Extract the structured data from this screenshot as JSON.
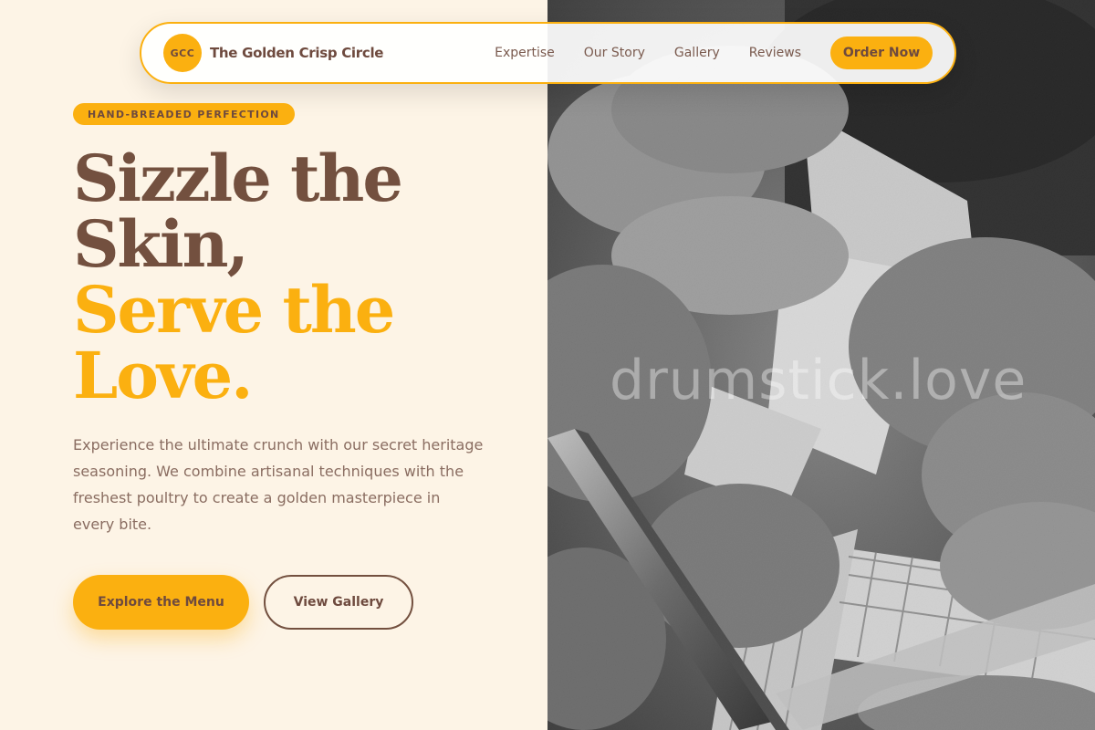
{
  "nav": {
    "logo_initials": "GCC",
    "brand_name": "The Golden Crisp Circle",
    "links": [
      "Expertise",
      "Our Story",
      "Gallery",
      "Reviews"
    ],
    "cta_label": "Order Now"
  },
  "hero": {
    "eyebrow": "HAND-BREADED PERFECTION",
    "headline_lines": [
      "Sizzle the",
      "Skin,",
      "Serve the",
      "Love."
    ],
    "description": "Experience the ultimate crunch with our secret heritage seasoning. We combine artisanal techniques with the freshest poultry to create a golden masterpiece in every bite.",
    "primary_button": "Explore the Menu",
    "secondary_button": "View Gallery"
  },
  "photo": {
    "watermark": "drumstick.love",
    "style": "grayscale"
  },
  "colors": {
    "accent": "#fbb010",
    "brown": "#73503f",
    "background": "#fdf4e6"
  }
}
